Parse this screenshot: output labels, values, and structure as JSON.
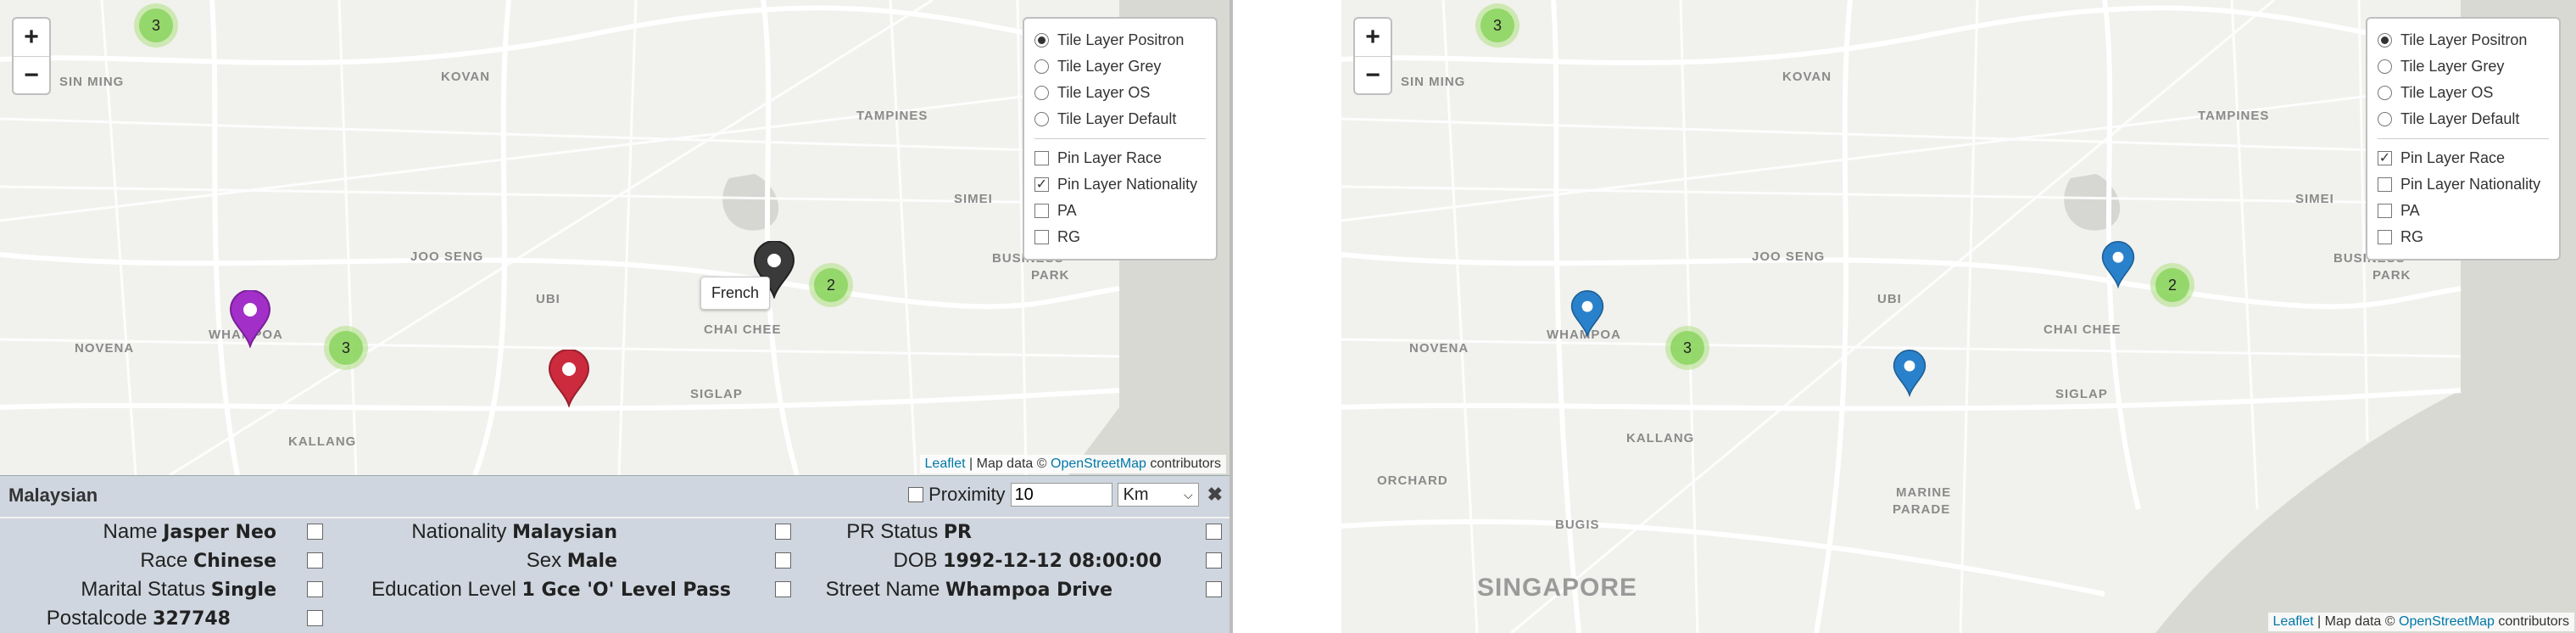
{
  "left_map": {
    "places": [
      "SIN MING",
      "KOVAN",
      "TAMPINES",
      "SIMEI",
      "JOO SENG",
      "BUSINESS",
      "PARK",
      "NOVENA",
      "UBI",
      "WHAMPOA",
      "CHAI CHEE",
      "KALLANG",
      "SIGLAP"
    ],
    "clusters": [
      "3",
      "3",
      "2"
    ],
    "tooltip": "French",
    "markers": [
      {
        "name": "purple",
        "color": "#a22fc8"
      },
      {
        "name": "dark",
        "color": "#3a3a3a"
      },
      {
        "name": "red",
        "color": "#cc2a3d"
      }
    ]
  },
  "right_map": {
    "places": [
      "SIN MING",
      "KOVAN",
      "TAMPINES",
      "SIMEI",
      "JOO SENG",
      "BUSINESS",
      "PARK",
      "NOVENA",
      "UBI",
      "WHAMPOA",
      "CHAI CHEE",
      "KALLANG",
      "SIGLAP",
      "ORCHARD",
      "BUGIS",
      "MARINE",
      "PARADE",
      "SINGAPORE"
    ],
    "clusters": [
      "3",
      "3",
      "2"
    ],
    "markers": [
      {
        "name": "blue",
        "color": "#2a81cb"
      }
    ]
  },
  "zoom": {
    "in": "+",
    "out": "−"
  },
  "left_layers": {
    "tiles": [
      {
        "label": "Tile Layer Positron",
        "selected": true
      },
      {
        "label": "Tile Layer Grey",
        "selected": false
      },
      {
        "label": "Tile Layer OS",
        "selected": false
      },
      {
        "label": "Tile Layer Default",
        "selected": false
      }
    ],
    "pins": [
      {
        "label": "Pin Layer Race",
        "checked": false
      },
      {
        "label": "Pin Layer Nationality",
        "checked": true
      },
      {
        "label": "PA",
        "checked": false
      },
      {
        "label": "RG",
        "checked": false
      }
    ]
  },
  "right_layers": {
    "tiles": [
      {
        "label": "Tile Layer Positron",
        "selected": true
      },
      {
        "label": "Tile Layer Grey",
        "selected": false
      },
      {
        "label": "Tile Layer OS",
        "selected": false
      },
      {
        "label": "Tile Layer Default",
        "selected": false
      }
    ],
    "pins": [
      {
        "label": "Pin Layer Race",
        "checked": true
      },
      {
        "label": "Pin Layer Nationality",
        "checked": false
      },
      {
        "label": "PA",
        "checked": false
      },
      {
        "label": "RG",
        "checked": false
      }
    ]
  },
  "attribution": {
    "leaflet": "Leaflet",
    "mid": " | Map data © ",
    "osm": "OpenStreetMap",
    "end": " contributors"
  },
  "info": {
    "title": "Malaysian",
    "proximity_label": "Proximity",
    "proximity_value": "10",
    "unit": "Km",
    "close": "✖",
    "fields": [
      {
        "label": "Name",
        "value": "Jasper Neo"
      },
      {
        "label": "Nationality",
        "value": "Malaysian"
      },
      {
        "label": "PR Status",
        "value": "PR"
      },
      {
        "label": "Race",
        "value": "Chinese"
      },
      {
        "label": "Sex",
        "value": "Male"
      },
      {
        "label": "DOB",
        "value": "1992-12-12 08:00:00"
      },
      {
        "label": "Marital Status",
        "value": "Single"
      },
      {
        "label": "Education Level",
        "value": "1 Gce 'O' Level Pass"
      },
      {
        "label": "Street Name",
        "value": "Whampoa Drive"
      },
      {
        "label": "Postalcode",
        "value": "327748"
      }
    ]
  }
}
